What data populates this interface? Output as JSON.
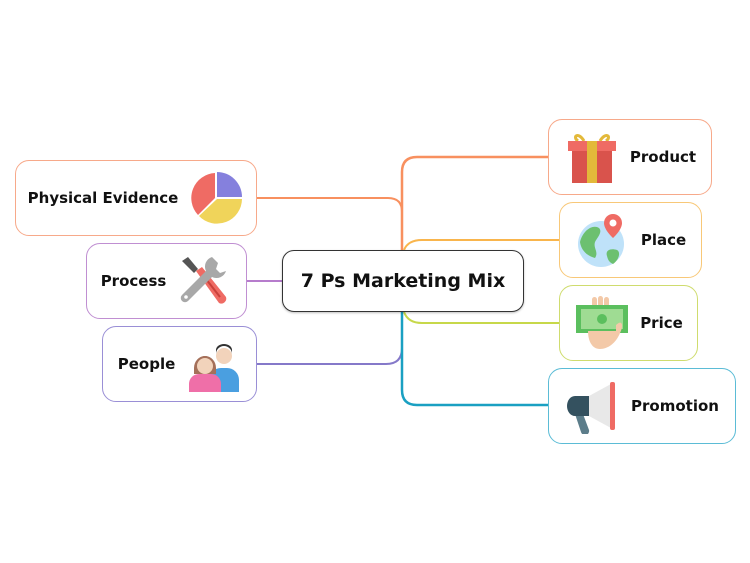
{
  "diagram": {
    "type": "mind-map",
    "central": {
      "label": "7 Ps Marketing Mix"
    },
    "branches": [
      {
        "id": "physical",
        "label": "Physical Evidence",
        "icon": "pie-chart-icon",
        "side": "left",
        "color": "#f8905f"
      },
      {
        "id": "process",
        "label": "Process",
        "icon": "tools-icon",
        "side": "left",
        "color": "#b67ccc"
      },
      {
        "id": "people",
        "label": "People",
        "icon": "people-icon",
        "side": "left",
        "color": "#8579c9"
      },
      {
        "id": "product",
        "label": "Product",
        "icon": "gift-icon",
        "side": "right",
        "color": "#f8905f"
      },
      {
        "id": "place",
        "label": "Place",
        "icon": "globe-pin-icon",
        "side": "right",
        "color": "#f9b54c"
      },
      {
        "id": "price",
        "label": "Price",
        "icon": "money-hand-icon",
        "side": "right",
        "color": "#c7d84a"
      },
      {
        "id": "promotion",
        "label": "Promotion",
        "icon": "megaphone-icon",
        "side": "right",
        "color": "#1aa0c2"
      }
    ]
  },
  "colors": {
    "pie_red": "#ef6b64",
    "pie_purple": "#8580dd",
    "pie_yellow": "#f0d45a",
    "gift_red": "#d9534c",
    "gift_ribbon": "#e3b93a",
    "globe_blue": "#bfe2f9",
    "globe_green": "#6cc070",
    "pin_red": "#ef6b64",
    "money_green": "#5bbf5e",
    "hand_skin": "#f3c9a8",
    "mega_dark": "#34515f",
    "mega_light": "#e8e8e8",
    "mega_red": "#ef6b64"
  }
}
